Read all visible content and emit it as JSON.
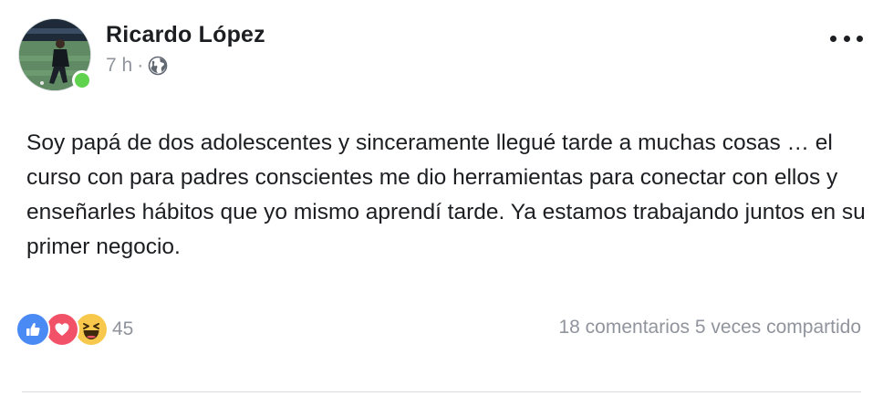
{
  "post": {
    "author": "Ricardo López",
    "time": "7 h",
    "separator": "·",
    "privacy_icon": "globe-icon",
    "more_icon": "more-options-icon",
    "body": "Soy papá de dos adolescentes y sinceramente llegué tarde a muchas cosas … el curso con para padres conscientes me dio herramientas para conectar con ellos y enseñarles hábitos que yo mismo aprendí tarde. Ya estamos trabajando juntos en su primer negocio."
  },
  "reactions": {
    "icons": [
      "like-icon",
      "love-icon",
      "haha-icon"
    ],
    "count": "45"
  },
  "stats": {
    "comments": "18 comentarios",
    "shares": "5 veces compartido"
  },
  "colors": {
    "online": "#5fd34d",
    "like": "#4a8af4",
    "love": "#f25268",
    "haha": "#f7c84b",
    "muted_text": "#90949c"
  }
}
